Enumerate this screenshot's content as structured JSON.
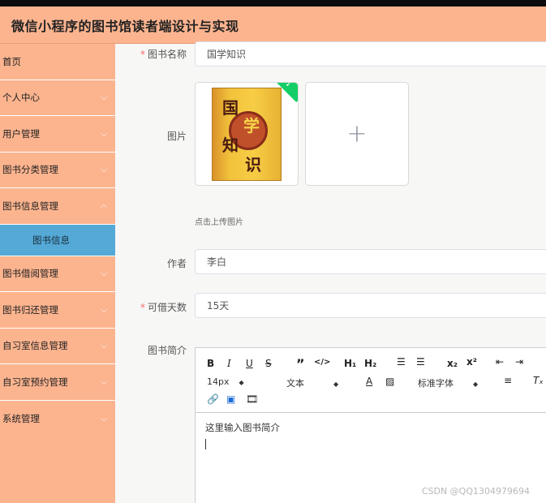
{
  "header": {
    "title": "微信小程序的图书馆读者端设计与实现"
  },
  "sidebar": {
    "items": [
      {
        "label": "首页",
        "chevron": false
      },
      {
        "label": "个人中心",
        "chevron": true
      },
      {
        "label": "用户管理",
        "chevron": true
      },
      {
        "label": "图书分类管理",
        "chevron": true
      },
      {
        "label": "图书信息管理",
        "chevron": true
      },
      {
        "label": "图书借阅管理",
        "chevron": true
      },
      {
        "label": "图书归还管理",
        "chevron": true
      },
      {
        "label": "自习室信息管理",
        "chevron": true
      },
      {
        "label": "自习室预约管理",
        "chevron": true
      },
      {
        "label": "系统管理",
        "chevron": true
      }
    ],
    "active_sub": "图书信息"
  },
  "form": {
    "book_name": {
      "label": "图书名称",
      "value": "国学知识"
    },
    "image": {
      "label": "图片",
      "hint": "点击上传图片",
      "cover_text": [
        "国",
        "学",
        "知",
        "识"
      ]
    },
    "author": {
      "label": "作者",
      "value": "李白"
    },
    "borrow_days": {
      "label": "可借天数",
      "value": "15天"
    },
    "intro": {
      "label": "图书简介",
      "placeholder": "这里输入图书简介"
    }
  },
  "editor": {
    "font_size": "14px",
    "paragraph": "文本",
    "font_family": "标准字体"
  },
  "watermark": "CSDN @QQ1304979694",
  "colors": {
    "header": "#fcb48f",
    "sidebar": "#fcb48f",
    "active_sub": "#54a9d6",
    "success": "#13ce66",
    "required": "#f56c6c"
  }
}
